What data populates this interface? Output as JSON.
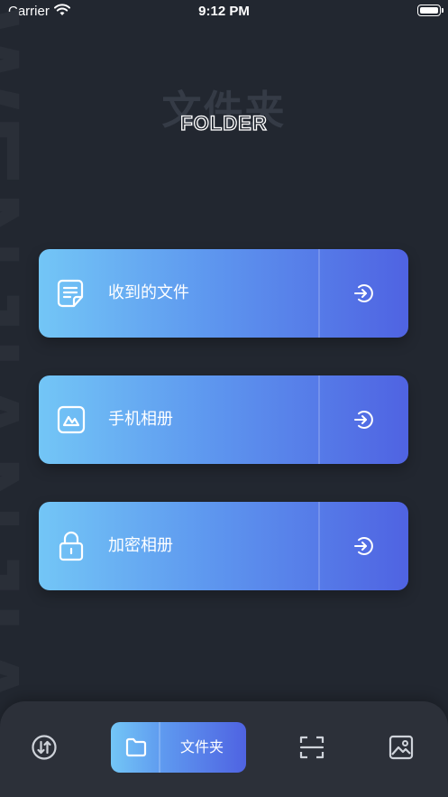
{
  "status_bar": {
    "carrier": "Carrier",
    "time": "9:12 PM"
  },
  "watermark": "WENJIANJIA",
  "header": {
    "title_cn": "文件夹",
    "title_en": "FOLDER"
  },
  "menu": [
    {
      "label": "收到的文件",
      "icon": "document-icon"
    },
    {
      "label": "手机相册",
      "icon": "photo-icon"
    },
    {
      "label": "加密相册",
      "icon": "lock-icon"
    }
  ],
  "tab_bar": {
    "active_label": "文件夹",
    "items": [
      "transfer-icon",
      "folder-icon",
      "scan-icon",
      "image-icon"
    ]
  },
  "colors": {
    "background": "#222730",
    "gradient_start": "#73c6f6",
    "gradient_end": "#4f63e2",
    "tab_bar": "#2c3039"
  }
}
